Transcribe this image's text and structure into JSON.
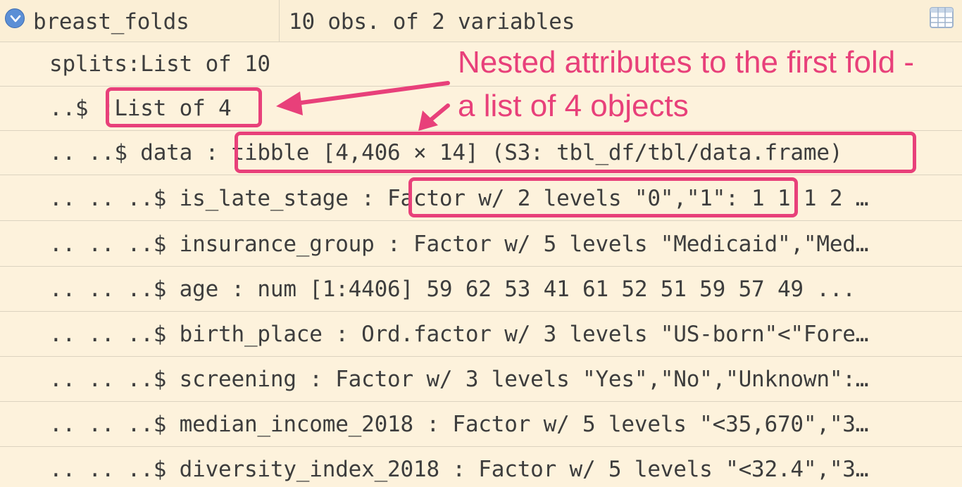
{
  "header": {
    "name": "breast_folds",
    "summary": "10 obs. of 2 variables"
  },
  "rows": [
    [
      "splits:List of 10"
    ],
    [
      "..$ :List of 4"
    ],
    [
      ".. ..$ data : tibble [4,406 × 14] (S3: tbl_df/tbl/data.frame)"
    ],
    [
      ".. .. ..$ is_late_stage : Factor w/ 2 levels \"0\",\"1\": 1 1 1 2 …"
    ],
    [
      ".. .. ..$ insurance_group : Factor w/ 5 levels \"Medicaid\",\"Med…"
    ],
    [
      ".. .. ..$ age : num [1:4406] 59 62 53 41 61 52 51 59 57 49 ..."
    ],
    [
      ".. .. ..$ birth_place : Ord.factor w/ 3 levels \"US-born\"<\"Fore…"
    ],
    [
      ".. .. ..$ screening : Factor w/ 3 levels \"Yes\",\"No\",\"Unknown\":…"
    ],
    [
      ".. .. ..$ median_income_2018 : Factor w/ 5 levels \"<35,670\",\"3…"
    ],
    [
      ".. .. ..$ diversity_index_2018 : Factor w/ 5 levels \"<32.4\",\"3…"
    ]
  ],
  "annotation": {
    "line1": "Nested attributes to the first fold -",
    "line2": "a list of 4 objects"
  },
  "colors": {
    "background": "#FDF2DC",
    "highlight": "#E8407A",
    "expand_button": "#5B8FD6"
  },
  "icons": {
    "expand": "chevron-down-icon",
    "view": "grid-table-icon"
  }
}
